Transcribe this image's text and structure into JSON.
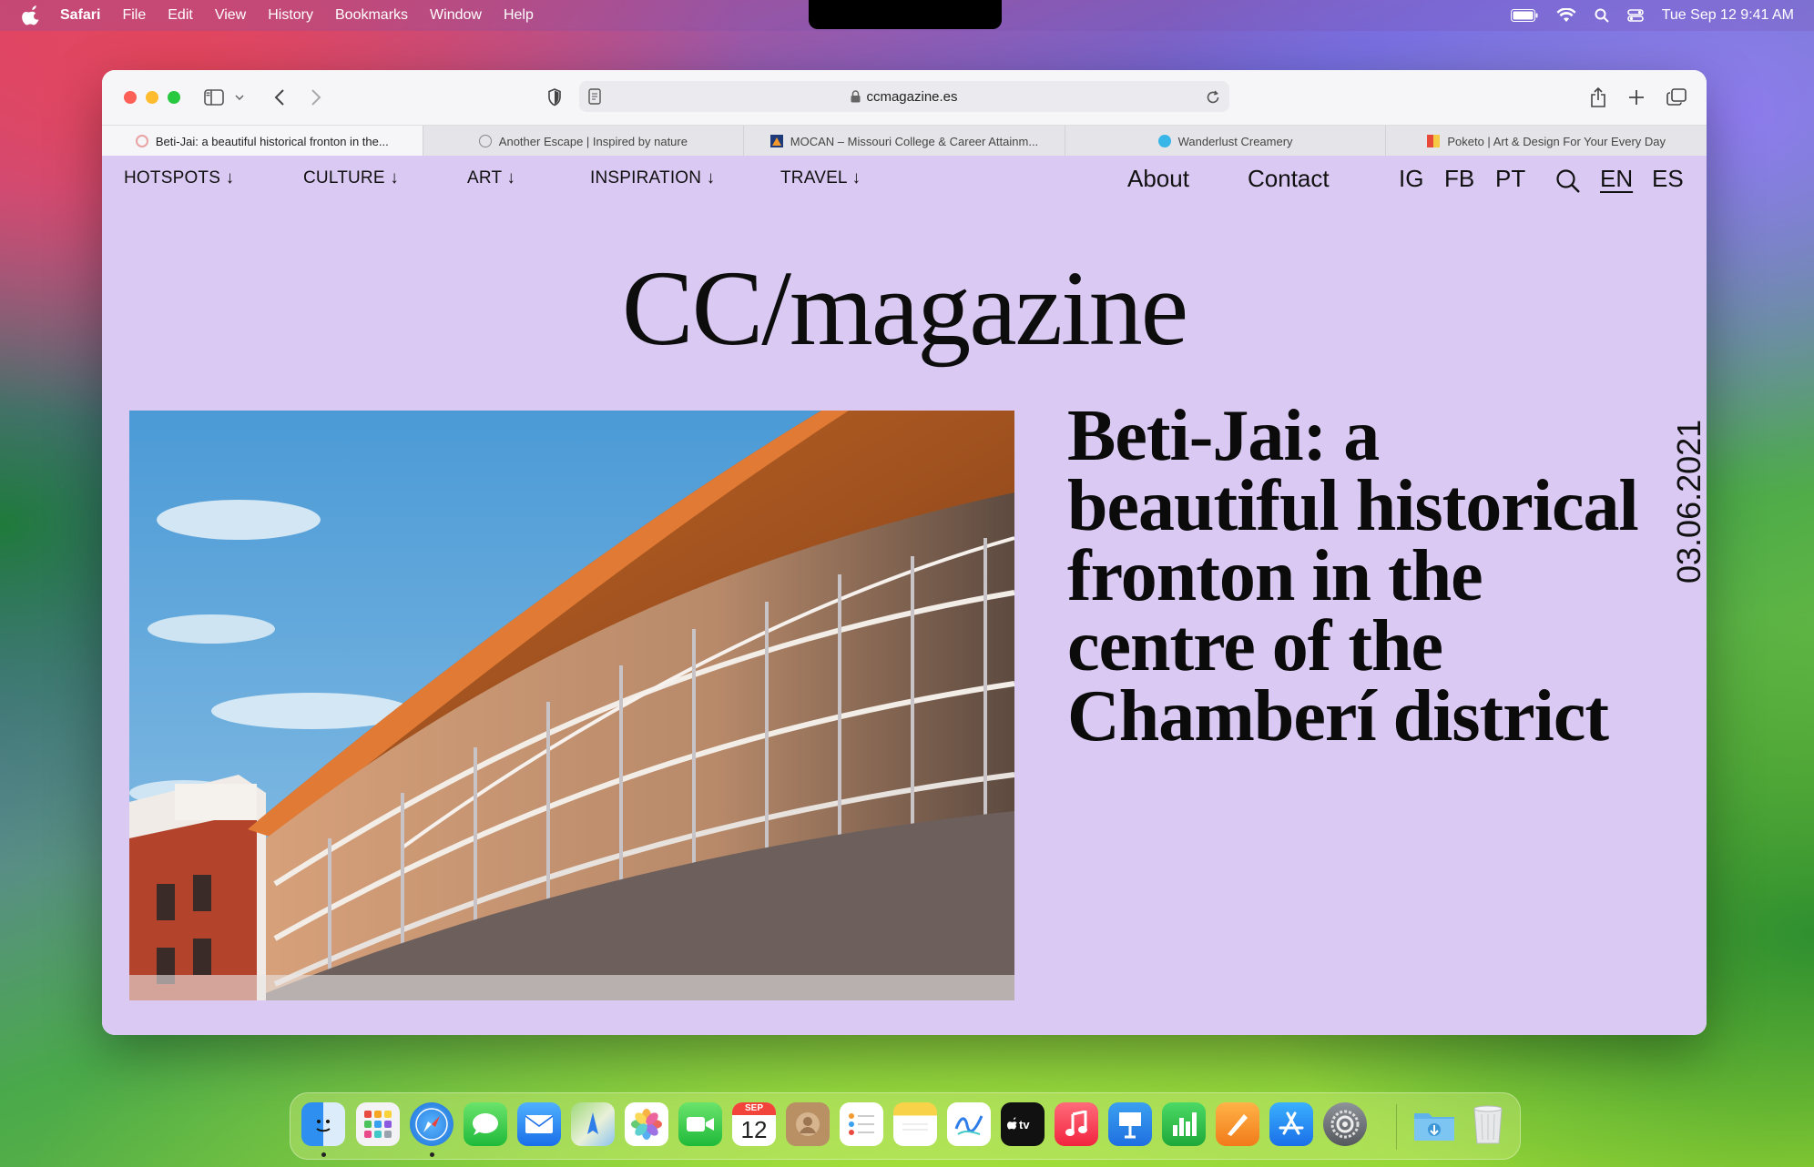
{
  "menubar": {
    "app_name": "Safari",
    "menus": [
      "File",
      "Edit",
      "View",
      "History",
      "Bookmarks",
      "Window",
      "Help"
    ],
    "datetime": "Tue Sep 12  9:41 AM"
  },
  "browser": {
    "url": "ccmagazine.es",
    "tabs": [
      {
        "label": "Beti-Jai: a beautiful historical fronton in the...",
        "favicon_color": "#e9a3a3"
      },
      {
        "label": "Another Escape | Inspired by nature",
        "favicon_color": "#888888"
      },
      {
        "label": "MOCAN – Missouri College & Career Attainm...",
        "favicon_color": "#1e3a78"
      },
      {
        "label": "Wanderlust Creamery",
        "favicon_color": "#39b6e8"
      },
      {
        "label": "Poketo | Art & Design For Your Every Day",
        "favicon_color": "#e84a3a"
      }
    ]
  },
  "site": {
    "nav": {
      "hotspots": "HOTSPOTS ↓",
      "culture": "CULTURE ↓",
      "art": "ART ↓",
      "inspiration": "INSPIRATION ↓",
      "travel": "TRAVEL ↓",
      "about": "About",
      "contact": "Contact",
      "ig": "IG",
      "fb": "FB",
      "pt": "PT",
      "en": "EN",
      "es": "ES"
    },
    "logo": "CC/magazine",
    "article": {
      "title": "Beti-Jai: a beautiful historical fronton in the centre of the Chamberí district",
      "date": "03.06.2021"
    }
  },
  "dock": {
    "calendar_month": "SEP",
    "calendar_day": "12",
    "apps": [
      "finder-icon",
      "launchpad-icon",
      "safari-icon",
      "messages-icon",
      "mail-icon",
      "maps-icon",
      "photos-icon",
      "facetime-icon",
      "calendar-icon",
      "contacts-icon",
      "reminders-icon",
      "notes-icon",
      "freeform-icon",
      "tv-icon",
      "music-icon",
      "keynote-icon",
      "numbers-icon",
      "pages-icon",
      "app-store-icon",
      "system-settings-icon",
      "downloads-icon",
      "trash-icon"
    ]
  },
  "colors": {
    "page_background": "#dac9f3",
    "text": "#0b0b0b"
  }
}
